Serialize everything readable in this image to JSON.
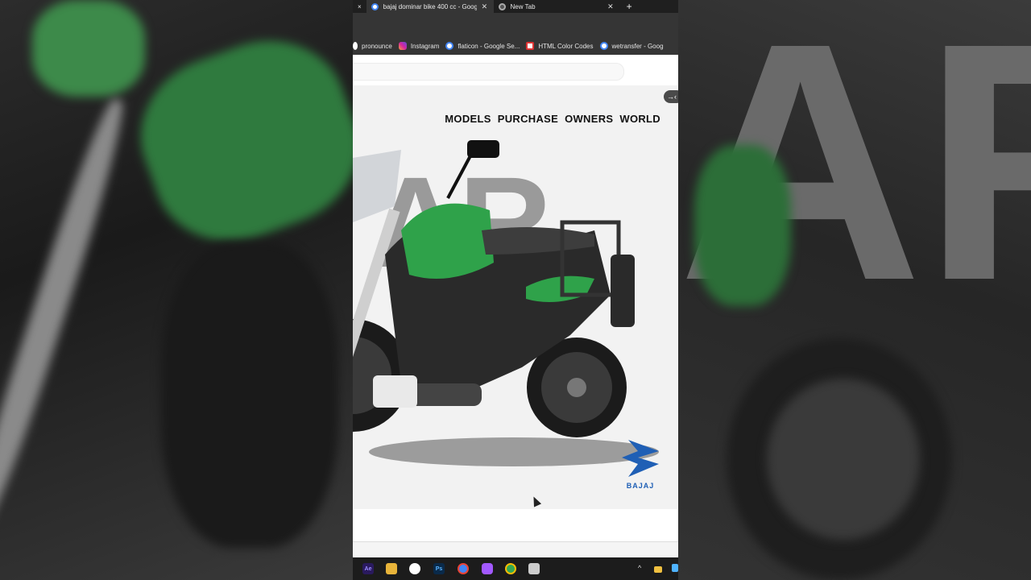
{
  "browser": {
    "tabs": [
      {
        "label": "bajaj dominar bike 400 cc - Goog",
        "active": true
      },
      {
        "label": "New Tab",
        "active": false
      }
    ],
    "first_tab_close": "×",
    "new_tab_symbol": "+",
    "bookmarks": [
      {
        "label": "pronounce",
        "icon": "google-icon"
      },
      {
        "label": "Instagram",
        "icon": "instagram-icon"
      },
      {
        "label": "flaticon - Google Se...",
        "icon": "google-icon"
      },
      {
        "label": "HTML Color Codes",
        "icon": "html-color-icon"
      },
      {
        "label": "wetransfer - Goog",
        "icon": "google-icon"
      }
    ]
  },
  "page": {
    "nav": [
      "MODELS",
      "PURCHASE",
      "OWNERS",
      "WORLD"
    ],
    "background_word": "AR",
    "brand_name": "BAJAJ",
    "toggle_symbol": "→‹"
  },
  "taskbar": {
    "apps": [
      {
        "name": "after-effects-icon",
        "label": "Ae",
        "color": "#2a1a5e"
      },
      {
        "name": "file-explorer-icon",
        "label": "",
        "color": "#e8b43a"
      },
      {
        "name": "slack-icon",
        "label": "",
        "color": "#ffffff"
      },
      {
        "name": "photoshop-icon",
        "label": "Ps",
        "color": "#0a2a4a"
      },
      {
        "name": "chrome-icon",
        "label": "",
        "color": "#4285f4"
      },
      {
        "name": "figma-icon",
        "label": "",
        "color": "#a259ff"
      },
      {
        "name": "chrome-profile-icon",
        "label": "",
        "color": "#34a853"
      },
      {
        "name": "app-icon",
        "label": "",
        "color": "#cccccc"
      }
    ],
    "tray_symbol": "^"
  },
  "colors": {
    "accent_green": "#2fa24a",
    "bajaj_blue": "#1f5fb5"
  }
}
